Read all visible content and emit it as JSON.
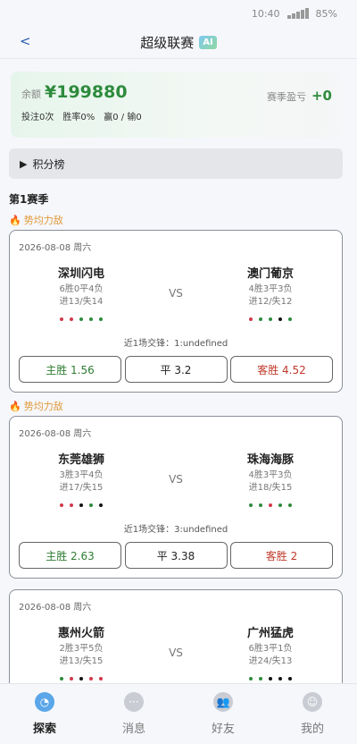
{
  "status": {
    "time": "10:40",
    "battery": "85%"
  },
  "header": {
    "back": "<",
    "title": "超级联赛",
    "badge": "AI"
  },
  "balance": {
    "label": "余额",
    "value": "¥199880",
    "season_label": "赛季盈亏",
    "season_value": "+0",
    "bets": "投注0次",
    "rate": "胜率0%",
    "record": "赢0 / 输0"
  },
  "standings": {
    "label": "积分榜"
  },
  "season_title": "第1赛季",
  "colors": {
    "win": "#2e8b3d",
    "loss": "#d0394a",
    "draw": "#111111"
  },
  "matches": [
    {
      "tag": "势均力敌",
      "date": "2026-08-08 周六",
      "home": {
        "name": "深圳闪电",
        "record": "6胜0平4负",
        "goals": "进13/失14",
        "form": [
          "L",
          "L",
          "W",
          "W",
          "W"
        ]
      },
      "away": {
        "name": "澳门葡京",
        "record": "4胜3平3负",
        "goals": "进12/失12",
        "form": [
          "L",
          "W",
          "W",
          "D",
          "W"
        ]
      },
      "vs": "VS",
      "h2h": "近1场交锋：1:undefined",
      "odds": {
        "home": "主胜 1.56",
        "draw": "平 3.2",
        "away": "客胜 4.52"
      }
    },
    {
      "tag": "势均力敌",
      "date": "2026-08-08 周六",
      "home": {
        "name": "东莞雄狮",
        "record": "3胜3平4负",
        "goals": "进17/失15",
        "form": [
          "L",
          "L",
          "D",
          "W",
          "D"
        ]
      },
      "away": {
        "name": "珠海海豚",
        "record": "4胜3平3负",
        "goals": "进18/失15",
        "form": [
          "W",
          "W",
          "L",
          "W",
          "W"
        ]
      },
      "vs": "VS",
      "h2h": "近1场交锋：3:undefined",
      "odds": {
        "home": "主胜 2.63",
        "draw": "平 3.38",
        "away": "客胜 2"
      }
    },
    {
      "tag": "",
      "date": "2026-08-08 周六",
      "home": {
        "name": "惠州火箭",
        "record": "2胜3平5负",
        "goals": "进13/失15",
        "form": [
          "W",
          "L",
          "D",
          "L",
          "L"
        ]
      },
      "away": {
        "name": "广州猛虎",
        "record": "6胜3平1负",
        "goals": "进24/失13",
        "form": [
          "W",
          "W",
          "D",
          "D",
          "D"
        ]
      },
      "vs": "VS",
      "h2h": "",
      "odds": {
        "home": "",
        "draw": "",
        "away": ""
      }
    }
  ],
  "tabs": [
    {
      "label": "探索",
      "icon": "explore-icon",
      "active": true
    },
    {
      "label": "消息",
      "icon": "message-icon",
      "active": false
    },
    {
      "label": "好友",
      "icon": "friends-icon",
      "active": false
    },
    {
      "label": "我的",
      "icon": "profile-icon",
      "active": false
    }
  ]
}
